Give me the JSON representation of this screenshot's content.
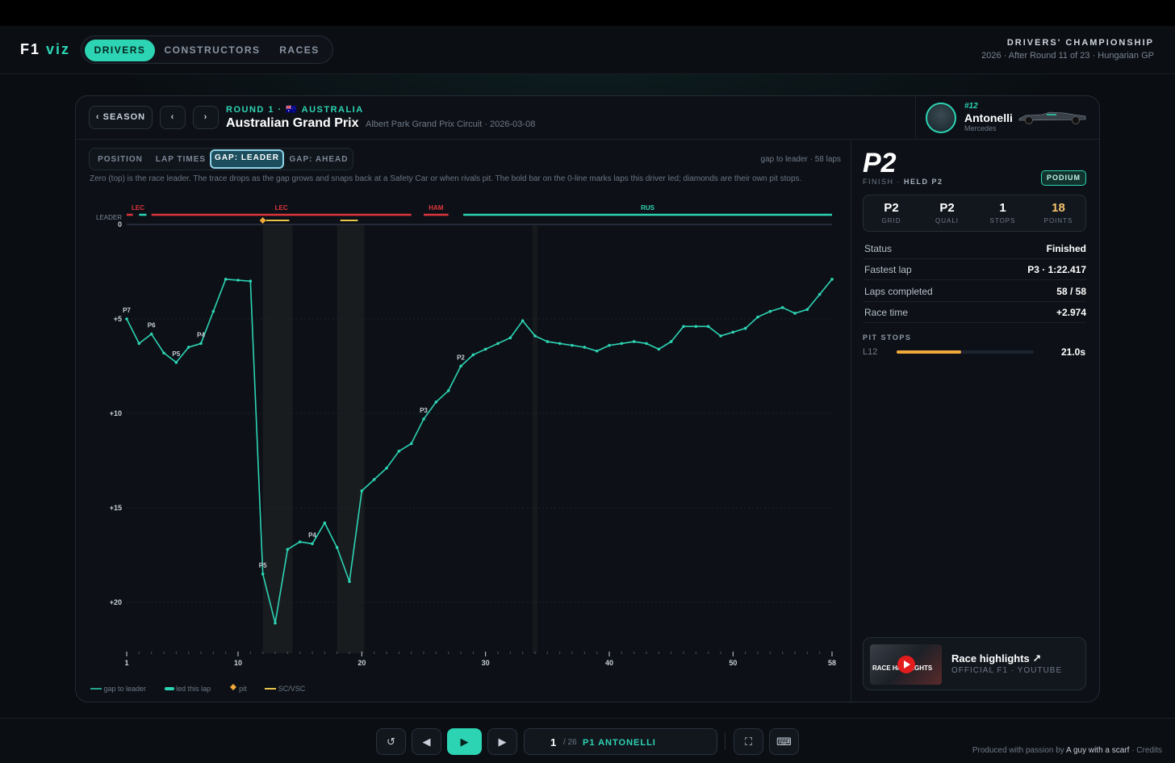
{
  "app": {
    "logo_a": "F1",
    "logo_b": "viz"
  },
  "nav": {
    "tabs": [
      "DRIVERS",
      "CONSTRUCTORS",
      "RACES"
    ],
    "active": 0
  },
  "championship": {
    "title": "DRIVERS' CHAMPIONSHIP",
    "subtitle": "2026 · After Round 11 of 23 · Hungarian GP"
  },
  "race": {
    "season_button": "‹ SEASON",
    "prev": "‹",
    "next": "›",
    "round_label": "ROUND 1 · 🇦🇺 AUSTRALIA",
    "title": "Australian Grand Prix",
    "subtitle": "Albert Park Grand Prix Circuit · 2026-03-08"
  },
  "driver": {
    "number": "#12",
    "name": "Antonelli",
    "team": "Mercedes"
  },
  "view_tabs": [
    "POSITION",
    "LAP TIMES",
    "GAP: LEADER",
    "GAP: AHEAD"
  ],
  "gap_note": "gap to leader · 58 laps",
  "description": "Zero (top) is the race leader. The trace drops as the gap grows and snaps back at a Safety Car or when rivals pit. The bold bar on the 0-line marks laps this driver led; diamonds are their own pit stops.",
  "legend": [
    "gap to leader",
    "led this lap",
    "pit",
    "SC/VSC"
  ],
  "colors": {
    "accent": "#2dd4b4",
    "red": "#e0343b",
    "gold": "#f2c26b",
    "pit": "#f2a93b"
  },
  "chart_data": {
    "type": "line",
    "title": "",
    "xlabel": "",
    "ylabel": "",
    "y_reversed": true,
    "xlim": [
      1,
      58
    ],
    "ylim": [
      0,
      23
    ],
    "x_ticks": [
      "1",
      "10",
      "20",
      "30",
      "40",
      "50",
      "58"
    ],
    "y_ticks": [
      "0",
      "+5",
      "+10",
      "+15",
      "+20"
    ],
    "y_zero_label": "LEADER",
    "x": [
      1,
      2,
      3,
      4,
      5,
      6,
      7,
      8,
      9,
      10,
      11,
      12,
      13,
      14,
      15,
      16,
      17,
      18,
      19,
      20,
      21,
      22,
      23,
      24,
      25,
      26,
      27,
      28,
      29,
      30,
      31,
      32,
      33,
      34,
      35,
      36,
      37,
      38,
      39,
      40,
      41,
      42,
      43,
      44,
      45,
      46,
      47,
      48,
      49,
      50,
      51,
      52,
      53,
      54,
      55,
      56,
      57,
      58
    ],
    "series": [
      {
        "values": [
          5.0,
          6.3,
          5.8,
          6.8,
          7.3,
          6.5,
          6.3,
          4.6,
          2.9,
          2.95,
          3.0,
          18.5,
          21.1,
          17.2,
          16.8,
          16.9,
          15.8,
          17.1,
          18.9,
          14.1,
          13.5,
          12.9,
          12.0,
          11.6,
          10.3,
          9.4,
          8.8,
          7.5,
          6.9,
          6.6,
          6.3,
          6.0,
          5.1,
          5.9,
          6.2,
          6.3,
          6.4,
          6.5,
          6.7,
          6.4,
          6.3,
          6.2,
          6.3,
          6.6,
          6.2,
          5.4,
          5.4,
          5.4,
          5.9,
          5.7,
          5.5,
          4.9,
          4.6,
          4.4,
          4.7,
          4.5,
          3.7,
          2.9
        ]
      }
    ],
    "position_labels": [
      {
        "x": 1,
        "label": "P7"
      },
      {
        "x": 3,
        "label": "P6"
      },
      {
        "x": 5,
        "label": "P5"
      },
      {
        "x": 7,
        "label": "P4"
      },
      {
        "x": 12,
        "label": "P5"
      },
      {
        "x": 16,
        "label": "P4"
      },
      {
        "x": 25,
        "label": "P3"
      },
      {
        "x": 28,
        "label": "P2"
      }
    ],
    "leader_bars": [
      {
        "from": 1,
        "to": 1.5,
        "driver": "LEC",
        "color": "#e0343b"
      },
      {
        "from": 2,
        "to": 2.6,
        "driver": "",
        "color": "#2dd4b4"
      },
      {
        "from": 3,
        "to": 24,
        "driver": "LEC",
        "color": "#e0343b"
      },
      {
        "from": 25,
        "to": 27,
        "driver": "HAM",
        "color": "#e0343b"
      },
      {
        "from": 28.2,
        "to": 58,
        "driver": "RUS",
        "color": "#2dd4b4"
      }
    ],
    "sc_periods": [
      {
        "from": 12,
        "to": 14.4
      },
      {
        "from": 18,
        "to": 20.2
      }
    ],
    "pit_laps": [
      12
    ],
    "gridlines": true
  },
  "summary": {
    "finish": "P2",
    "finish_label": "FINISH",
    "held": "HELD P2",
    "badge": "PODIUM",
    "stats": [
      {
        "value": "P2",
        "label": "GRID"
      },
      {
        "value": "P2",
        "label": "QUALI"
      },
      {
        "value": "1",
        "label": "STOPS"
      },
      {
        "value": "18",
        "label": "POINTS"
      }
    ],
    "rows": [
      {
        "k": "Status",
        "v": "Finished"
      },
      {
        "k": "Fastest lap",
        "v": "P3 · 1:22.417"
      },
      {
        "k": "Laps completed",
        "v": "58 / 58"
      },
      {
        "k": "Race time",
        "v": "+2.974"
      }
    ],
    "pit_header": "PIT STOPS",
    "pits": [
      {
        "lap": "L12",
        "time": "21.0s",
        "fraction": 0.47
      }
    ]
  },
  "highlights": {
    "title": "Race highlights ↗",
    "subtitle": "OFFICIAL F1 · YOUTUBE",
    "thumb_text": "RACE HIGHLIGHTS"
  },
  "playback": {
    "lap": "1",
    "total": "/ 26",
    "leader": "P1 ANTONELLI"
  },
  "footer": {
    "prefix": "Produced with passion by",
    "author": "A guy with a scarf",
    "link": "· Credits"
  }
}
